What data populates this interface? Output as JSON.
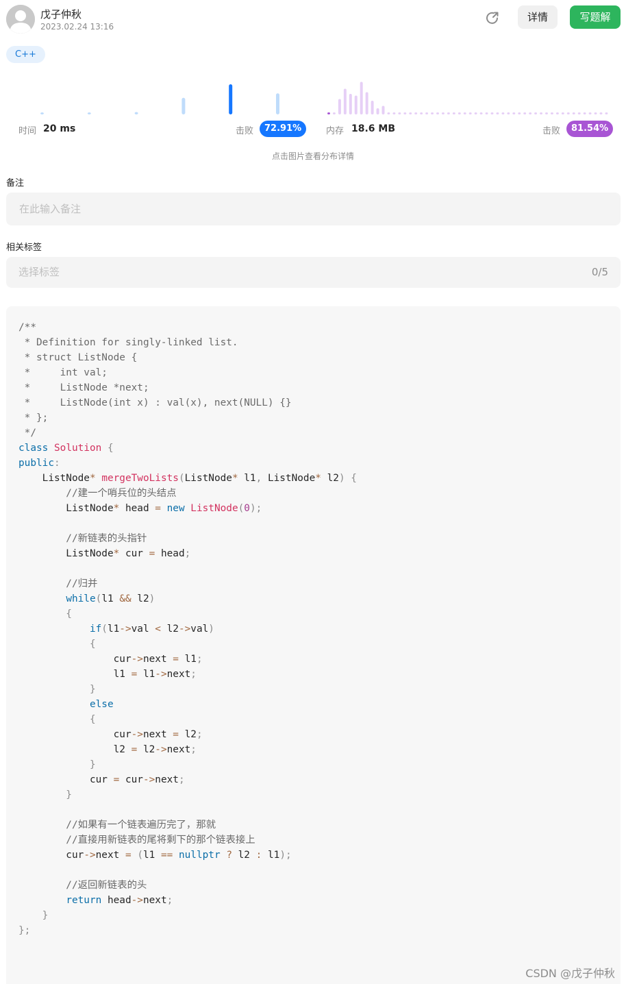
{
  "header": {
    "username": "戊子仲秋",
    "timestamp": "2023.02.24 13:16",
    "share_icon": "share-icon",
    "detail_label": "详情",
    "write_label": "写题解"
  },
  "language_tag": "C++",
  "runtime": {
    "label": "时间",
    "value": "20 ms",
    "beat_label": "击败",
    "beat_value": "72.91%",
    "color": "#1677ff",
    "distribution": [
      0.04,
      0.04,
      0.08,
      0.55,
      1.0,
      0.7
    ]
  },
  "memory": {
    "label": "内存",
    "value": "18.6 MB",
    "beat_label": "击败",
    "beat_value": "81.54%",
    "color": "#a855d4",
    "distribution": [
      0.06,
      0.05,
      0.45,
      0.75,
      0.6,
      0.55,
      0.95,
      0.65,
      0.4,
      0.18,
      0.25,
      0.05,
      0.05,
      0.05,
      0.05,
      0.05,
      0.05,
      0.05,
      0.05,
      0.05,
      0.05,
      0.05,
      0.05,
      0.05,
      0.05,
      0.05,
      0.05,
      0.05,
      0.05,
      0.05,
      0.05,
      0.05,
      0.05,
      0.05,
      0.05,
      0.05,
      0.05,
      0.05,
      0.05,
      0.05,
      0.05,
      0.05,
      0.05,
      0.05,
      0.05,
      0.05,
      0.05,
      0.05,
      0.05,
      0.05,
      0.05,
      0.05
    ]
  },
  "click_hint": "点击图片查看分布详情",
  "note": {
    "label": "备注",
    "placeholder": "在此输入备注"
  },
  "tags": {
    "label": "相关标签",
    "placeholder": "选择标签",
    "count": "0/5"
  },
  "code_lines": [
    [
      [
        "c-cm",
        "/**"
      ]
    ],
    [
      [
        "c-cm",
        " * Definition for singly-linked list."
      ]
    ],
    [
      [
        "c-cm",
        " * struct ListNode {"
      ]
    ],
    [
      [
        "c-cm",
        " *     int val;"
      ]
    ],
    [
      [
        "c-cm",
        " *     ListNode *next;"
      ]
    ],
    [
      [
        "c-cm",
        " *     ListNode(int x) : val(x), next(NULL) {}"
      ]
    ],
    [
      [
        "c-cm",
        " * };"
      ]
    ],
    [
      [
        "c-cm",
        " */"
      ]
    ],
    [
      [
        "c-kw",
        "class"
      ],
      [
        "",
        " "
      ],
      [
        "c-fn",
        "Solution"
      ],
      [
        "",
        " "
      ],
      [
        "c-p",
        "{"
      ]
    ],
    [
      [
        "c-kw",
        "public"
      ],
      [
        "c-p",
        ":"
      ]
    ],
    [
      [
        "",
        "    ListNode"
      ],
      [
        "c-op",
        "*"
      ],
      [
        "",
        " "
      ],
      [
        "c-fn",
        "mergeTwoLists"
      ],
      [
        "c-p",
        "("
      ],
      [
        "",
        "ListNode"
      ],
      [
        "c-op",
        "*"
      ],
      [
        "",
        " l1"
      ],
      [
        "c-p",
        ","
      ],
      [
        "",
        " ListNode"
      ],
      [
        "c-op",
        "*"
      ],
      [
        "",
        " l2"
      ],
      [
        "c-p",
        ")"
      ],
      [
        "",
        " "
      ],
      [
        "c-p",
        "{"
      ]
    ],
    [
      [
        "c-cm",
        "        //建一个哨兵位的头结点"
      ]
    ],
    [
      [
        "",
        "        ListNode"
      ],
      [
        "c-op",
        "*"
      ],
      [
        "",
        " head "
      ],
      [
        "c-op",
        "="
      ],
      [
        "",
        " "
      ],
      [
        "c-kw",
        "new"
      ],
      [
        "",
        " "
      ],
      [
        "c-fn",
        "ListNode"
      ],
      [
        "c-p",
        "("
      ],
      [
        "c-nm",
        "0"
      ],
      [
        "c-p",
        ");"
      ]
    ],
    [
      [
        "",
        ""
      ]
    ],
    [
      [
        "c-cm",
        "        //新链表的头指针"
      ]
    ],
    [
      [
        "",
        "        ListNode"
      ],
      [
        "c-op",
        "*"
      ],
      [
        "",
        " cur "
      ],
      [
        "c-op",
        "="
      ],
      [
        "",
        " head"
      ],
      [
        "c-p",
        ";"
      ]
    ],
    [
      [
        "",
        ""
      ]
    ],
    [
      [
        "c-cm",
        "        //归并"
      ]
    ],
    [
      [
        "",
        "        "
      ],
      [
        "c-kw",
        "while"
      ],
      [
        "c-p",
        "("
      ],
      [
        "",
        "l1 "
      ],
      [
        "c-op",
        "&&"
      ],
      [
        "",
        " l2"
      ],
      [
        "c-p",
        ")"
      ]
    ],
    [
      [
        "c-p",
        "        {"
      ]
    ],
    [
      [
        "",
        "            "
      ],
      [
        "c-kw",
        "if"
      ],
      [
        "c-p",
        "("
      ],
      [
        "",
        "l1"
      ],
      [
        "c-op",
        "->"
      ],
      [
        "",
        "val "
      ],
      [
        "c-op",
        "<"
      ],
      [
        "",
        " l2"
      ],
      [
        "c-op",
        "->"
      ],
      [
        "",
        "val"
      ],
      [
        "c-p",
        ")"
      ]
    ],
    [
      [
        "c-p",
        "            {"
      ]
    ],
    [
      [
        "",
        "                cur"
      ],
      [
        "c-op",
        "->"
      ],
      [
        "",
        "next "
      ],
      [
        "c-op",
        "="
      ],
      [
        "",
        " l1"
      ],
      [
        "c-p",
        ";"
      ]
    ],
    [
      [
        "",
        "                l1 "
      ],
      [
        "c-op",
        "="
      ],
      [
        "",
        " l1"
      ],
      [
        "c-op",
        "->"
      ],
      [
        "",
        "next"
      ],
      [
        "c-p",
        ";"
      ]
    ],
    [
      [
        "c-p",
        "            }"
      ]
    ],
    [
      [
        "",
        "            "
      ],
      [
        "c-kw",
        "else"
      ]
    ],
    [
      [
        "c-p",
        "            {"
      ]
    ],
    [
      [
        "",
        "                cur"
      ],
      [
        "c-op",
        "->"
      ],
      [
        "",
        "next "
      ],
      [
        "c-op",
        "="
      ],
      [
        "",
        " l2"
      ],
      [
        "c-p",
        ";"
      ]
    ],
    [
      [
        "",
        "                l2 "
      ],
      [
        "c-op",
        "="
      ],
      [
        "",
        " l2"
      ],
      [
        "c-op",
        "->"
      ],
      [
        "",
        "next"
      ],
      [
        "c-p",
        ";"
      ]
    ],
    [
      [
        "c-p",
        "            }"
      ]
    ],
    [
      [
        "",
        "            cur "
      ],
      [
        "c-op",
        "="
      ],
      [
        "",
        " cur"
      ],
      [
        "c-op",
        "->"
      ],
      [
        "",
        "next"
      ],
      [
        "c-p",
        ";"
      ]
    ],
    [
      [
        "c-p",
        "        }"
      ]
    ],
    [
      [
        "",
        ""
      ]
    ],
    [
      [
        "c-cm",
        "        //如果有一个链表遍历完了，那就"
      ]
    ],
    [
      [
        "c-cm",
        "        //直接用新链表的尾将剩下的那个链表接上"
      ]
    ],
    [
      [
        "",
        "        cur"
      ],
      [
        "c-op",
        "->"
      ],
      [
        "",
        "next "
      ],
      [
        "c-op",
        "="
      ],
      [
        "",
        " "
      ],
      [
        "c-p",
        "("
      ],
      [
        "",
        "l1 "
      ],
      [
        "c-op",
        "=="
      ],
      [
        "",
        " "
      ],
      [
        "c-kw",
        "nullptr"
      ],
      [
        "",
        " "
      ],
      [
        "c-op",
        "?"
      ],
      [
        "",
        " l2 "
      ],
      [
        "c-op",
        ":"
      ],
      [
        "",
        " l1"
      ],
      [
        "c-p",
        ");"
      ]
    ],
    [
      [
        "",
        ""
      ]
    ],
    [
      [
        "c-cm",
        "        //返回新链表的头"
      ]
    ],
    [
      [
        "",
        "        "
      ],
      [
        "c-kw",
        "return"
      ],
      [
        "",
        " head"
      ],
      [
        "c-op",
        "->"
      ],
      [
        "",
        "next"
      ],
      [
        "c-p",
        ";"
      ]
    ],
    [
      [
        "c-p",
        "    }"
      ]
    ],
    [
      [
        "c-p",
        "};"
      ]
    ]
  ],
  "watermark": "CSDN @戊子仲秋"
}
